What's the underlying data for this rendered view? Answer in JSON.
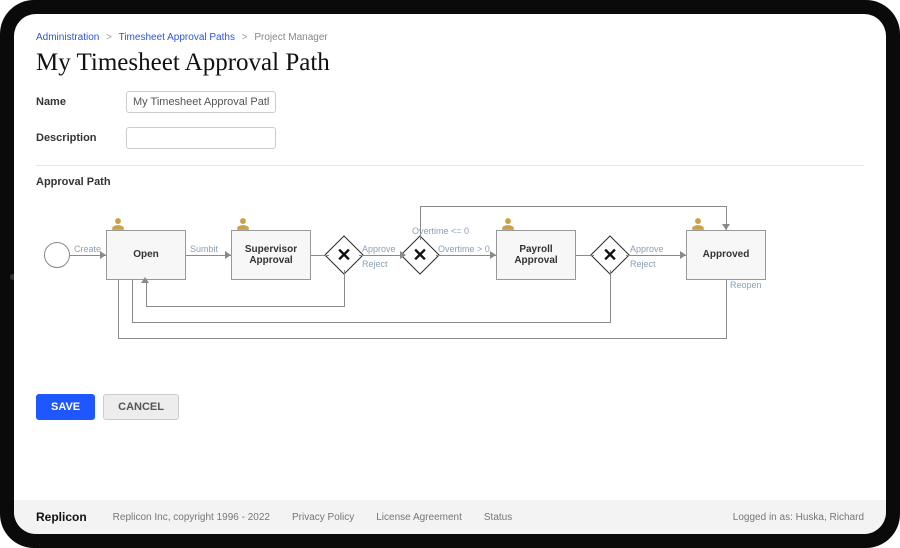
{
  "breadcrumb": {
    "a": "Administration",
    "b": "Timesheet Approval Paths",
    "c": "Project Manager"
  },
  "page_title": "My Timesheet Approval Path",
  "form": {
    "name_label": "Name",
    "name_value": "My Timesheet Approval Path",
    "description_label": "Description",
    "description_value": ""
  },
  "section_title": "Approval Path",
  "diagram": {
    "nodes": {
      "open": "Open",
      "supervisor": "Supervisor Approval",
      "payroll": "Payroll Approval",
      "approved": "Approved"
    },
    "edge_labels": {
      "create": "Create",
      "submit": "Sumbit",
      "approve1": "Approve",
      "reject1": "Reject",
      "ot_le0": "Overtime <= 0",
      "ot_gt0": "Overtime > 0",
      "approve2": "Approve",
      "reject2": "Reject",
      "reopen": "Reopen"
    }
  },
  "buttons": {
    "save": "SAVE",
    "cancel": "CANCEL"
  },
  "footer": {
    "brand": "Replicon",
    "copyright": "Replicon Inc, copyright 1996 - 2022",
    "privacy": "Privacy Policy",
    "license": "License Agreement",
    "status": "Status",
    "logged_in_prefix": "Logged in as:",
    "user": "Huska, Richard"
  }
}
